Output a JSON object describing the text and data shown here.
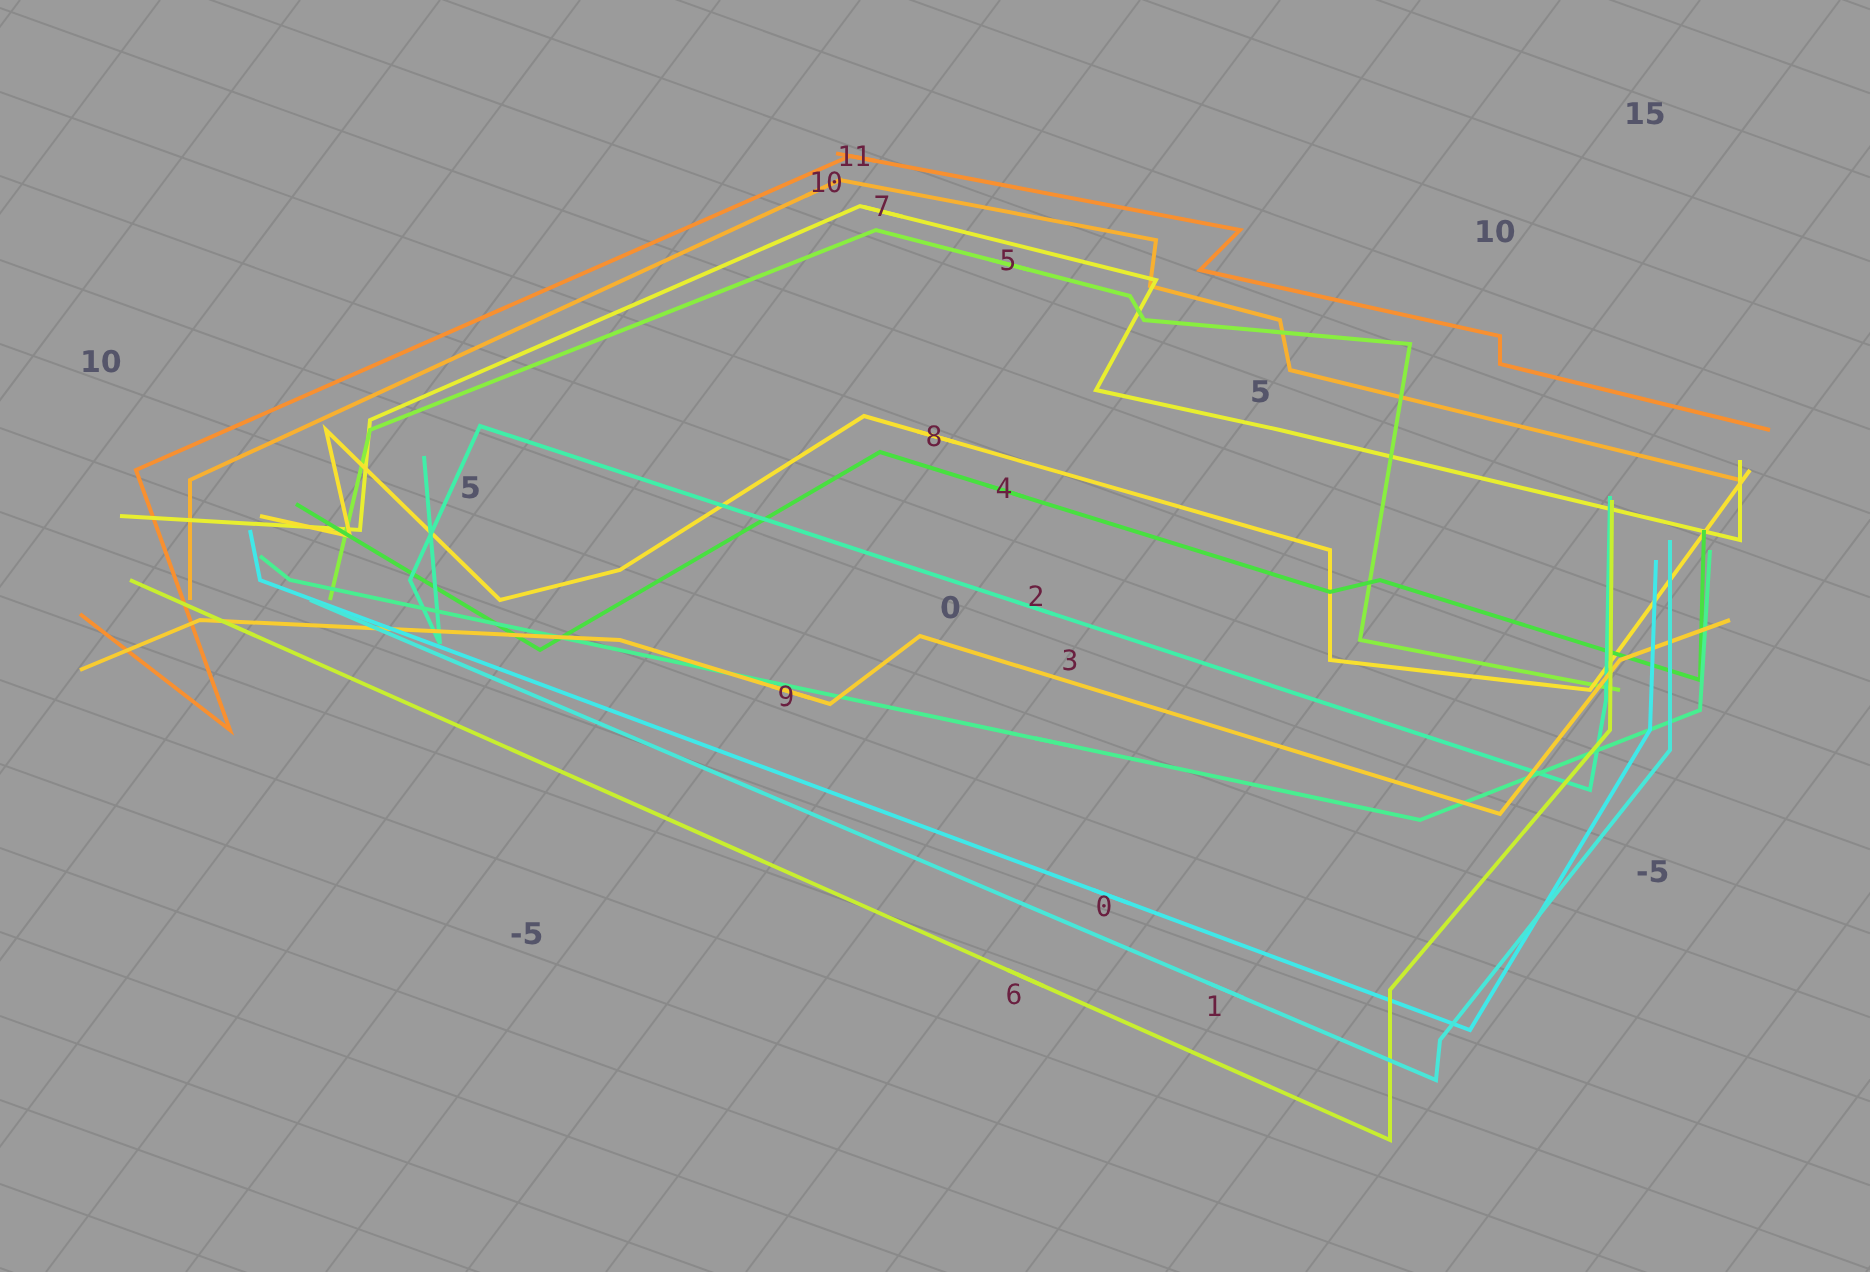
{
  "viewport": {
    "grid_labels": [
      "15",
      "10",
      "10",
      "5",
      "5",
      "0",
      "-5",
      "-5"
    ],
    "wires": [
      {
        "label": "11",
        "color": "#f89030"
      },
      {
        "label": "10",
        "color": "#f8b030"
      },
      {
        "label": "7",
        "color": "#e8ee30"
      },
      {
        "label": "5",
        "color": "#88ee40"
      },
      {
        "label": "8",
        "color": "#f8e030"
      },
      {
        "label": "4",
        "color": "#48e040"
      },
      {
        "label": "2",
        "color": "#40eea8"
      },
      {
        "label": "3",
        "color": "#48ee90"
      },
      {
        "label": "9",
        "color": "#f8cc30"
      },
      {
        "label": "0",
        "color": "#40e8e8"
      },
      {
        "label": "6",
        "color": "#c8ee30"
      },
      {
        "label": "1",
        "color": "#48e6d8"
      }
    ]
  }
}
